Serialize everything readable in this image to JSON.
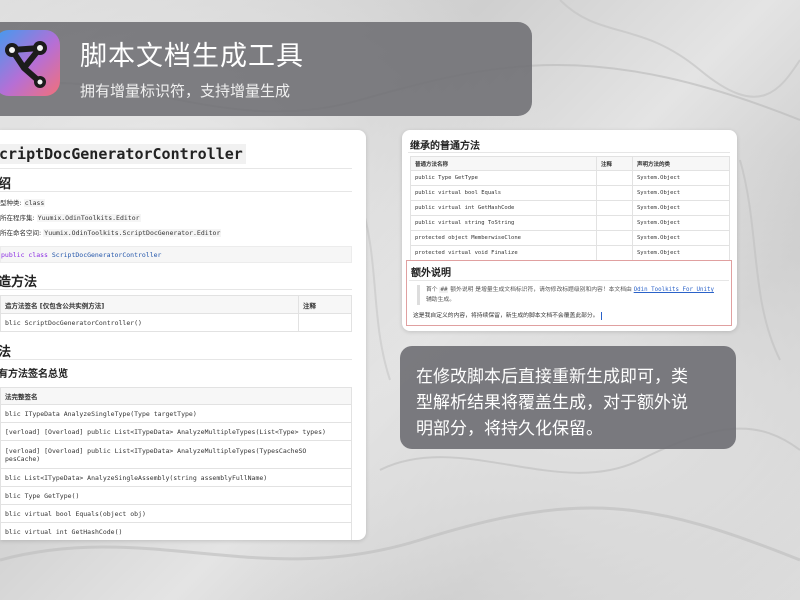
{
  "header": {
    "title": "脚本文档生成工具",
    "subtitle": "拥有增量标识符，支持增量生成"
  },
  "doc_left": {
    "title": "criptDocGeneratorController",
    "intro_heading": "绍",
    "meta": [
      {
        "label": "型种类:",
        "value": "class"
      },
      {
        "label": "所在程序集:",
        "value": "Yuumix.OdinToolkits.Editor"
      },
      {
        "label": "所在命名空间:",
        "value": "Yuumix.OdinToolkits.ScriptDocGenerator.Editor"
      }
    ],
    "declaration": {
      "keywords": "public class",
      "name": "ScriptDocGeneratorController"
    },
    "ctor_heading": "造方法",
    "ctor_table": {
      "headers": [
        "造方法签名 [仅包含公共实例方法]",
        "注释"
      ],
      "rows": [
        [
          "blic ScriptDocGeneratorController()",
          ""
        ]
      ]
    },
    "methods_heading": "法",
    "methods_subheading": "有方法签名总览",
    "methods_table": {
      "header": "法完整签名",
      "rows": [
        "blic ITypeData AnalyzeSingleType(Type targetType)",
        "[verload] [Overload] public List<ITypeData> AnalyzeMultipleTypes(List<Type> types)",
        "[verload] [Overload] public List<ITypeData> AnalyzeMultipleTypes(TypesCacheSO",
        "pesCache)",
        "blic List<ITypeData> AnalyzeSingleAssembly(string assemblyFullName)",
        "blic Type GetType()",
        "blic virtual bool Equals(object obj)",
        "blic virtual int GetHashCode()"
      ]
    }
  },
  "doc_right": {
    "inherited_heading": "继承的普通方法",
    "inherited_table": {
      "headers": [
        "普通方法名称",
        "注释",
        "声明方法的类"
      ],
      "rows": [
        [
          "public Type GetType",
          "",
          "System.Object"
        ],
        [
          "public virtual bool Equals",
          "",
          "System.Object"
        ],
        [
          "public virtual int GetHashCode",
          "",
          "System.Object"
        ],
        [
          "public virtual string ToString",
          "",
          "System.Object"
        ],
        [
          "protected object MemberwiseClone",
          "",
          "System.Object"
        ],
        [
          "protected virtual void Finalize",
          "",
          "System.Object"
        ]
      ]
    },
    "extra_heading": "额外说明",
    "quote": {
      "prefix": "首个",
      "code": "##",
      "text": "额外说明 是增量生成文档标识符，请勿修改标题级别和内容！本文档由",
      "link": "Odin Toolkits For Unity",
      "suffix": "辅助生成。"
    },
    "custom_note": "这是我自定义的内容，将持续保留，新生成的脚本文档不会覆盖此部分。"
  },
  "note": {
    "lines": [
      "在修改脚本后直接重新生成即可，类",
      "型解析结果将覆盖生成，对于额外说",
      "明部分，将持久化保留。"
    ]
  },
  "colors": {
    "banner_bg": "#6e6e73",
    "keyword": "#8a2be2",
    "link": "#2a62c9",
    "icon_gradient": [
      "#3f9cf0",
      "#b56fd6",
      "#f1707a"
    ]
  }
}
